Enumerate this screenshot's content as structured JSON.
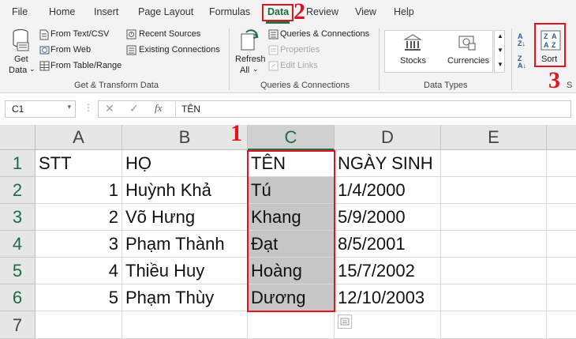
{
  "menu": [
    "File",
    "Home",
    "Insert",
    "Page Layout",
    "Formulas",
    "Data",
    "Review",
    "View",
    "Help"
  ],
  "ribbon": {
    "get_data": {
      "line1": "Get",
      "line2": "Data"
    },
    "get_transform_items": [
      "From Text/CSV",
      "From Web",
      "From Table/Range"
    ],
    "recent_items": [
      "Recent Sources",
      "Existing Connections"
    ],
    "get_transform_label": "Get & Transform Data",
    "refresh": {
      "line1": "Refresh",
      "line2": "All"
    },
    "queries_items": [
      "Queries & Connections",
      "Properties",
      "Edit Links"
    ],
    "queries_label": "Queries & Connections",
    "data_types": [
      "Stocks",
      "Currencies"
    ],
    "data_types_label": "Data Types",
    "sort_label": "Sort",
    "cut_label": "S"
  },
  "formula_bar": {
    "name_box": "C1",
    "fx": "fx",
    "formula": "TÊN"
  },
  "sheet": {
    "columns": [
      "A",
      "B",
      "C",
      "D",
      "E"
    ],
    "rows": [
      "1",
      "2",
      "3",
      "4",
      "5",
      "6",
      "7"
    ],
    "cells": [
      [
        "STT",
        "HỌ",
        "TÊN",
        "NGÀY SINH",
        ""
      ],
      [
        "1",
        "Huỳnh Khả",
        "Tú",
        "1/4/2000",
        ""
      ],
      [
        "2",
        "Võ Hưng",
        "Khang",
        "5/9/2000",
        ""
      ],
      [
        "3",
        "Phạm Thành",
        "Đạt",
        "8/5/2001",
        ""
      ],
      [
        "4",
        "Thiều Huy",
        "Hoàng",
        "15/7/2002",
        ""
      ],
      [
        "5",
        "Phạm Thùy",
        "Dương",
        "12/10/2003",
        ""
      ],
      [
        "",
        "",
        "",
        "",
        ""
      ]
    ]
  },
  "annotations": [
    "1",
    "2",
    "3"
  ],
  "colors": {
    "accent_green": "#217346",
    "highlight_red": "#e0141e",
    "selection_gray": "#c6c6c6"
  }
}
